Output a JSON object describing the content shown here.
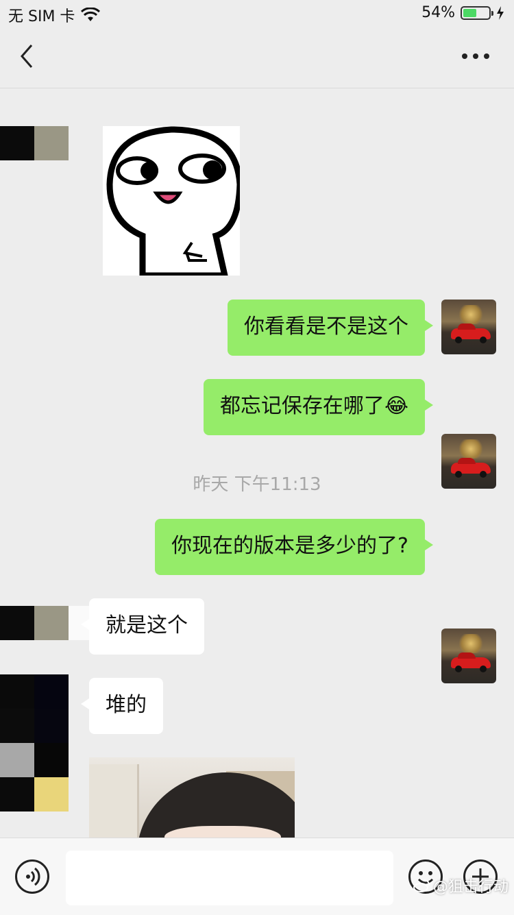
{
  "status": {
    "carrier": "无 SIM 卡",
    "battery_percent": "54%",
    "battery_level": 0.54
  },
  "nav": {
    "back_icon": "chevron-left-icon",
    "more_icon": "more-dots-icon"
  },
  "messages": {
    "m1": "你看看是不是这个",
    "m2_text": "都忘记保存在哪了",
    "m2_emoji": "😂",
    "timestamp": "昨天 下午11:13",
    "m3": "你现在的版本是多少的了?",
    "m4": "就是这个",
    "m5": "堆的"
  },
  "watermark": {
    "text": "@狙击行动"
  },
  "colors": {
    "sent_bubble": "#95ec69",
    "received_bubble": "#ffffff",
    "background": "#ededed"
  }
}
